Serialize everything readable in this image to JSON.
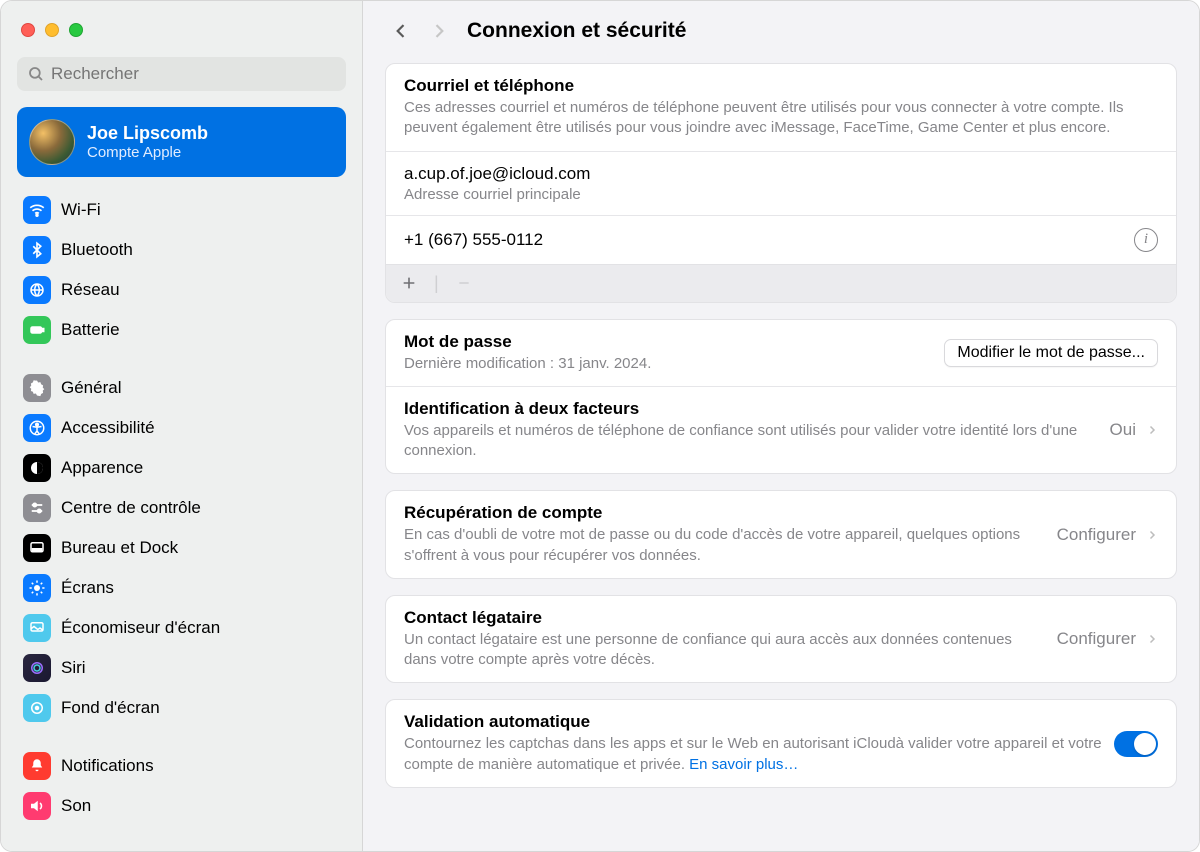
{
  "search": {
    "placeholder": "Rechercher"
  },
  "account": {
    "name": "Joe Lipscomb",
    "sub": "Compte Apple"
  },
  "sidebar": {
    "group1": [
      {
        "label": "Wi-Fi"
      },
      {
        "label": "Bluetooth"
      },
      {
        "label": "Réseau"
      },
      {
        "label": "Batterie"
      }
    ],
    "group2": [
      {
        "label": "Général"
      },
      {
        "label": "Accessibilité"
      },
      {
        "label": "Apparence"
      },
      {
        "label": "Centre de contrôle"
      },
      {
        "label": "Bureau et Dock"
      },
      {
        "label": "Écrans"
      },
      {
        "label": "Économiseur d'écran"
      },
      {
        "label": "Siri"
      },
      {
        "label": "Fond d'écran"
      }
    ],
    "group3": [
      {
        "label": "Notifications"
      },
      {
        "label": "Son"
      }
    ]
  },
  "header": {
    "title": "Connexion et sécurité"
  },
  "email": {
    "title": "Courriel et téléphone",
    "desc": "Ces adresses courriel et numéros de téléphone peuvent être utilisés pour vous connecter à votre compte. Ils peuvent également être utilisés pour vous joindre avec iMessage, FaceTime, Game Center et plus encore.",
    "primary": "a.cup.of.joe@icloud.com",
    "primary_label": "Adresse courriel principale",
    "phone": "+1 (667) 555-0112"
  },
  "password": {
    "title": "Mot de passe",
    "desc": "Dernière modification : 31 janv. 2024.",
    "button": "Modifier le mot de passe..."
  },
  "twofa": {
    "title": "Identification à deux facteurs",
    "desc": "Vos appareils et numéros de téléphone de confiance sont utilisés pour valider votre identité lors d'une connexion.",
    "value": "Oui"
  },
  "recovery": {
    "title": "Récupération de compte",
    "desc": "En cas d'oubli de votre mot de passe ou du code d'accès de votre appareil, quelques options s'offrent à vous pour récupérer vos données.",
    "value": "Configurer"
  },
  "legacy": {
    "title": "Contact légataire",
    "desc": "Un contact légataire est une personne de confiance qui aura accès aux données contenues dans votre compte après votre décès.",
    "value": "Configurer"
  },
  "autoval": {
    "title": "Validation automatique",
    "desc": "Contournez les captchas dans les apps et sur le Web en autorisant iCloudà valider votre appareil et votre compte de manière automatique et privée. ",
    "link": "En savoir plus…"
  }
}
